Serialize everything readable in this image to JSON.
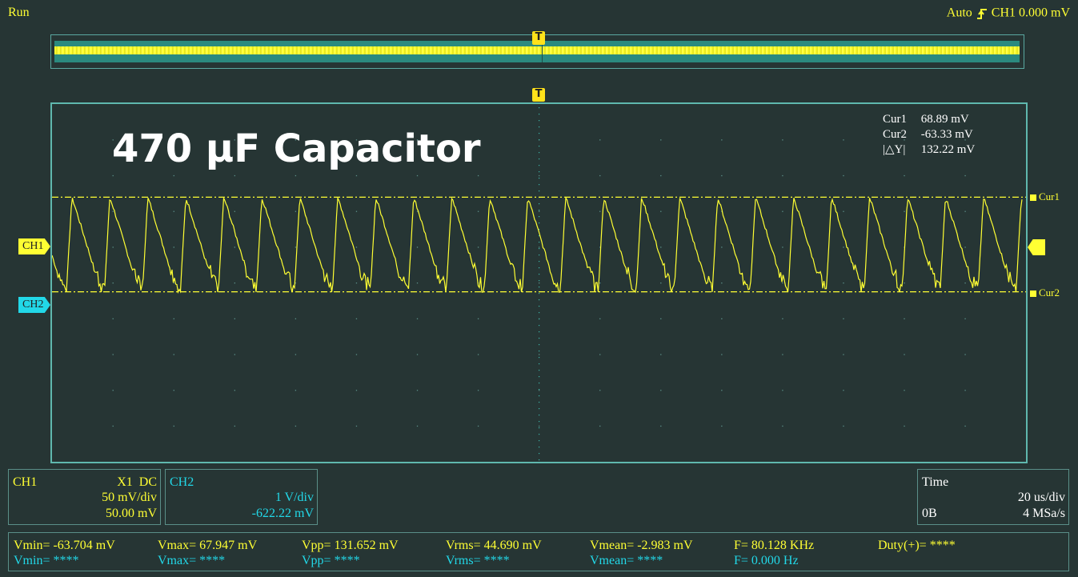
{
  "status": {
    "run_state": "Run"
  },
  "trigger": {
    "mode": "Auto",
    "source": "CH1",
    "level": "0.000 mV",
    "marker": "T"
  },
  "overlay": {
    "title": "470 µF Capacitor"
  },
  "cursors": {
    "cur1_label": "Cur1",
    "cur1_value": "68.89 mV",
    "cur2_label": "Cur2",
    "cur2_value": "-63.33 mV",
    "delta_label": "|△Y|",
    "delta_value": "132.22 mV",
    "cur1_marker": "Cur1",
    "cur2_marker": "Cur2"
  },
  "channel_markers": {
    "ch1": "CH1",
    "ch2": "CH2"
  },
  "ch1_panel": {
    "name": "CH1",
    "probe": "X1",
    "coupling": "DC",
    "scale": "50 mV/div",
    "offset": "50.00 mV"
  },
  "ch2_panel": {
    "name": "CH2",
    "scale": "1 V/div",
    "offset": "-622.22 mV"
  },
  "time_panel": {
    "name": "Time",
    "scale": "20 us/div",
    "memory": "0B",
    "rate": "4 MSa/s"
  },
  "measurements": {
    "ch1": {
      "vmin": "Vmin= -63.704 mV",
      "vmax": "Vmax= 67.947 mV",
      "vpp": "Vpp= 131.652 mV",
      "vrms": "Vrms= 44.690 mV",
      "vmean": "Vmean= -2.983 mV",
      "freq": "F= 80.128 KHz",
      "duty": "Duty(+)= ****"
    },
    "ch2": {
      "vmin": "Vmin= ****",
      "vmax": "Vmax= ****",
      "vpp": "Vpp= ****",
      "vrms": "Vrms= ****",
      "vmean": "Vmean= ****",
      "freq": "F= 0.000 Hz"
    }
  },
  "colors": {
    "ch1": "#ffff33",
    "ch2": "#22d8e8",
    "grid_border": "#5fb8ae",
    "background": "#263534"
  },
  "waveform": {
    "frequency_khz": 80.128,
    "vmax_mv": 67.947,
    "vmin_mv": -63.704,
    "volts_per_div_mv": 50
  }
}
